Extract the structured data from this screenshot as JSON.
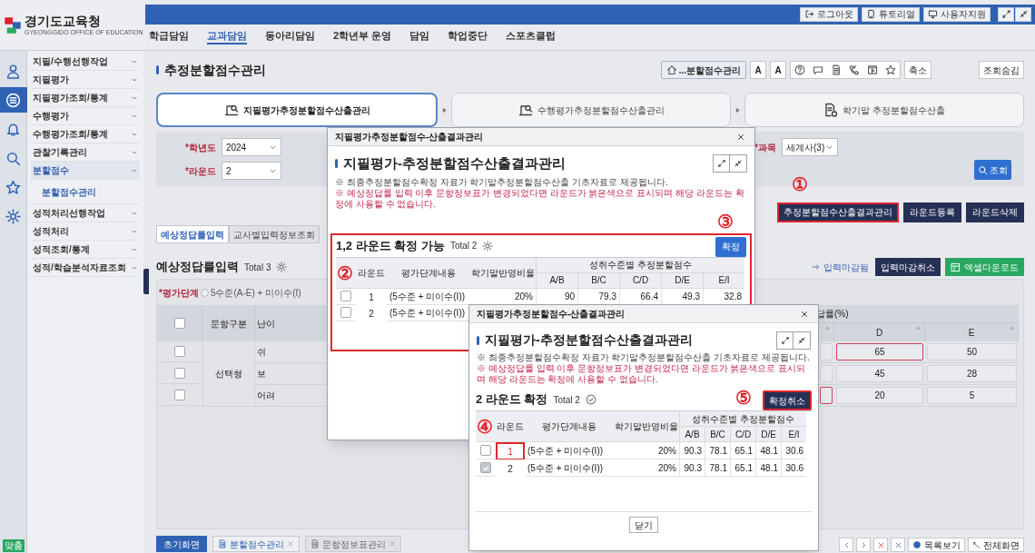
{
  "header": {
    "org_name": "경기도교육청",
    "org_subtitle": "GYEONGGIDO OFFICE OF EDUCATION",
    "top_buttons": [
      {
        "kind": "logout",
        "label": "로그아웃"
      },
      {
        "kind": "tutorial",
        "label": "튜토리얼"
      },
      {
        "kind": "support",
        "label": "사용자지원"
      }
    ]
  },
  "nav": [
    {
      "label": "학급담임",
      "selected": false
    },
    {
      "label": "교과담임",
      "selected": true
    },
    {
      "label": "동아리담임",
      "selected": false
    },
    {
      "label": "2학년부 운영",
      "selected": false
    },
    {
      "label": "담임",
      "selected": false
    },
    {
      "label": "학업중단",
      "selected": false
    },
    {
      "label": "스포츠클럽",
      "selected": false
    }
  ],
  "icon_rail": {
    "items": [
      {
        "kind": "person",
        "selected": false
      },
      {
        "kind": "list",
        "selected": true
      },
      {
        "kind": "bell",
        "selected": false
      },
      {
        "kind": "search",
        "selected": false
      },
      {
        "kind": "star",
        "selected": false
      },
      {
        "kind": "gear",
        "selected": false
      }
    ],
    "badge": "맞춤"
  },
  "sidebar": [
    {
      "label": "지필/수행선행작업",
      "expanded": false
    },
    {
      "label": "지필평가",
      "expanded": false
    },
    {
      "label": "지필평가조회/통계",
      "expanded": false
    },
    {
      "label": "수행평가",
      "expanded": false
    },
    {
      "label": "수행평가조회/통계",
      "expanded": false
    },
    {
      "label": "관찰기록관리",
      "expanded": false
    },
    {
      "label": "분할점수",
      "expanded": true,
      "children": [
        {
          "label": "분할점수관리"
        }
      ]
    },
    {
      "label": "성적처리선행작업",
      "expanded": false
    },
    {
      "label": "성적처리",
      "expanded": false
    },
    {
      "label": "성적조회/통계",
      "expanded": false
    },
    {
      "label": "성적/학습분석자료조회",
      "expanded": false
    }
  ],
  "page": {
    "title": "추정분할점수관리",
    "toolbar": {
      "breadcrumb": "...분할점수관리",
      "font_buttons": [
        "A",
        "A"
      ],
      "shrink": "축소",
      "hide_search": "조회숨김"
    }
  },
  "steps": [
    {
      "kind": "exam",
      "label": "지필평가추정분할점수산출관리",
      "selected": true
    },
    {
      "kind": "exam",
      "label": "수행평가추정분할점수산출관리",
      "selected": false
    },
    {
      "kind": "document",
      "label": "학기말 추정분할점수산출",
      "selected": false
    }
  ],
  "filters": {
    "year": {
      "label": "*학년도",
      "value": "2024"
    },
    "round": {
      "label": "*라운드",
      "value": "2"
    },
    "subject": {
      "label": "*과목",
      "value": "세계사(3)"
    },
    "search_button": "조회"
  },
  "actions": [
    {
      "label": "추정분할점수산출결과관리",
      "highlighted": true,
      "marker": "①"
    },
    {
      "label": "라운드등록",
      "highlighted": false
    },
    {
      "label": "라운드삭제",
      "highlighted": false
    }
  ],
  "tabs": [
    {
      "label": "예상정답률입력",
      "selected": true
    },
    {
      "label": "교사별입력정보조회",
      "selected": false
    }
  ],
  "answer_rate": {
    "title": "예상정답률입력",
    "total": "Total 3",
    "closed_note": "입력마감됨",
    "buttons": [
      {
        "kind": "cancel",
        "label": "입력마감취소"
      },
      {
        "kind": "excel",
        "label": "엑셀다운로드"
      }
    ],
    "level_label": "*평가단계",
    "level_option": "5수준(A-E) + 미이수(I)",
    "level_selected": false,
    "all_checked": false,
    "columns": {
      "type": "문항구분",
      "difficulty": "난이",
      "group": "답률(%)",
      "right": [
        "D",
        "E"
      ]
    },
    "type_cell": "선택형",
    "rows": [
      {
        "checked": false,
        "difficulty": "쉬",
        "cells": [
          {
            "invalid": false
          },
          {
            "value": "65",
            "invalid": true
          },
          {
            "value": "50",
            "invalid": false
          }
        ]
      },
      {
        "checked": false,
        "difficulty": "보",
        "cells": [
          {
            "invalid": false
          },
          {
            "value": "45",
            "invalid": false
          },
          {
            "value": "28",
            "invalid": false
          }
        ]
      },
      {
        "checked": false,
        "difficulty": "어려",
        "cells": [
          {
            "invalid": true
          },
          {
            "value": "20",
            "invalid": false
          },
          {
            "value": "5",
            "invalid": false
          }
        ]
      }
    ]
  },
  "bottom_bar": {
    "home": "초기화면",
    "tabs": [
      {
        "label": "분할점수관리",
        "selected": true
      },
      {
        "label": "문항정보표관리",
        "selected": false
      }
    ],
    "list_button": "목록보기",
    "fullscreen_button": "전체화면"
  },
  "dialogs": [
    {
      "window_title": "지필평가추정분할점수-산출결과관리",
      "heading": "지필평가-추정분할점수산출결과관리",
      "notes": [
        {
          "kind": "info",
          "text": "※ 최종추정분할점수확정 자료가 학기말추정분할점수산출 기초자료로 제공됩니다."
        },
        {
          "kind": "warning",
          "text": "※ 예상정답률 입력 이후 문항정보표가 변경되었다면 라운드가 붉은색으로 표시되며 해당 라운드는 확정에 사용할 수 없습니다."
        }
      ],
      "section_marker": "③",
      "section": {
        "title": "1,2 라운드 확정 가능",
        "total": "Total 2",
        "highlighted": true,
        "button": {
          "kind": "confirm",
          "label": "확정",
          "highlighted": false
        }
      },
      "table_marker": "②",
      "columns": {
        "round": "라운드",
        "content": "평가단계내용",
        "ratio": "학기말반영비율",
        "group": "성취수준별 추정분할점수",
        "levels": [
          "A/B",
          "B/C",
          "C/D",
          "D/E",
          "E/I"
        ]
      },
      "rows": [
        {
          "checked": false,
          "round": "1",
          "round_invalid": false,
          "round_highlighted": false,
          "content": "(5수준 + 미이수(I))",
          "ratio": "20%",
          "scores": [
            "90",
            "79.3",
            "66.4",
            "49.3",
            "32.8"
          ]
        },
        {
          "checked": false,
          "round": "2",
          "round_invalid": false,
          "round_highlighted": false,
          "content": "(5수준 + 미이수(I))"
        }
      ]
    },
    {
      "window_title": "지필평가추정분할점수-산출결과관리",
      "heading": "지필평가-추정분할점수산출결과관리",
      "notes": [
        {
          "kind": "info",
          "text": "※ 최종추정분할점수확정 자료가 학기말추정분할점수산출 기초자료로 제공됩니다."
        },
        {
          "kind": "warning",
          "text": "※ 예상정답률 입력 이후 문항정보표가 변경되었다면 라운드가 붉은색으로 표시되며 해당 라운드는 확정에 사용할 수 없습니다."
        }
      ],
      "section": {
        "title": "2 라운드 확정",
        "total": "Total 2",
        "highlighted": false,
        "button": {
          "kind": "cancel",
          "label": "확정취소",
          "highlighted": true,
          "marker": "⑤"
        }
      },
      "table_marker": "④",
      "columns": {
        "round": "라운드",
        "content": "평가단계내용",
        "ratio": "학기말반영비율",
        "group": "성취수준별 추정분할점수",
        "levels": [
          "A/B",
          "B/C",
          "C/D",
          "D/E",
          "E/I"
        ]
      },
      "rows": [
        {
          "checked": false,
          "round": "1",
          "round_invalid": true,
          "round_highlighted": true,
          "content": "(5수준 + 미이수(I))",
          "ratio": "20%",
          "scores": [
            "90.3",
            "78.1",
            "65.1",
            "48.1",
            "30.6"
          ]
        },
        {
          "checked": true,
          "round": "2",
          "round_invalid": false,
          "round_highlighted": false,
          "content": "(5수준 + 미이수(I))",
          "ratio": "20%",
          "scores": [
            "90.3",
            "78.1",
            "65.1",
            "48.1",
            "30.6"
          ]
        }
      ],
      "footer_button": "닫기"
    }
  ]
}
